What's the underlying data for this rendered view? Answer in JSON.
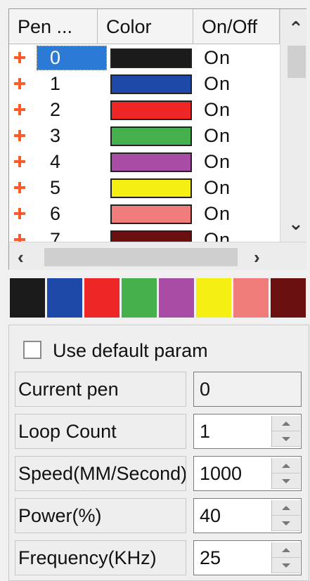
{
  "columns": {
    "pen": "Pen ...",
    "color": "Color",
    "onoff": "On/Off"
  },
  "pens": [
    {
      "number": "0",
      "color": "#1b1b1b",
      "state": "On",
      "selected": true
    },
    {
      "number": "1",
      "color": "#1f49a8",
      "state": "On"
    },
    {
      "number": "2",
      "color": "#ee2626",
      "state": "On"
    },
    {
      "number": "3",
      "color": "#47b04e",
      "state": "On"
    },
    {
      "number": "4",
      "color": "#a94ca6",
      "state": "On"
    },
    {
      "number": "5",
      "color": "#f4ee12",
      "state": "On"
    },
    {
      "number": "6",
      "color": "#f07c7c",
      "state": "On"
    },
    {
      "number": "7",
      "color": "#6b1010",
      "state": "On"
    }
  ],
  "palette": [
    "#1b1b1b",
    "#1f49a8",
    "#ee2626",
    "#47b04e",
    "#a94ca6",
    "#f4ee12",
    "#f07c7c",
    "#6b1010"
  ],
  "use_default": {
    "label": "Use default param",
    "checked": false
  },
  "params": [
    {
      "label": "Current pen",
      "value": "0",
      "spinner": false
    },
    {
      "label": "Loop Count",
      "value": "1",
      "spinner": true
    },
    {
      "label": "Speed(MM/Second)",
      "value": "1000",
      "spinner": true
    },
    {
      "label": "Power(%)",
      "value": "40",
      "spinner": true
    },
    {
      "label": "Frequency(KHz)",
      "value": "25",
      "spinner": true
    }
  ],
  "icons": {
    "row_marker": "pen-marker-icon",
    "scroll_up": "chevron-up-icon",
    "scroll_down": "chevron-down-icon",
    "scroll_left": "chevron-left-icon",
    "scroll_right": "chevron-right-icon"
  }
}
